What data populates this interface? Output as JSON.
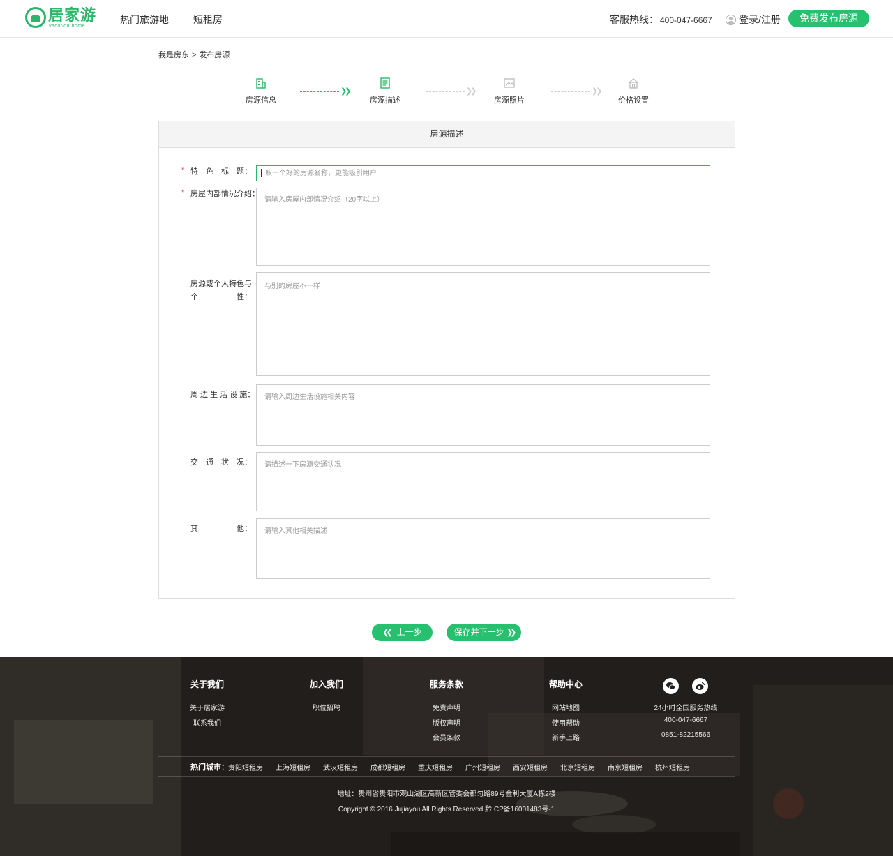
{
  "header": {
    "logo_text": "居家游",
    "logo_sub": "vacation home",
    "nav": [
      "热门旅游地",
      "短租房"
    ],
    "hotline_label": "客服热线：",
    "hotline_number": "400-047-6667",
    "login": "登录/注册",
    "publish": "免费发布房源"
  },
  "breadcrumb": {
    "items": [
      "我是房东",
      "发布房源"
    ],
    "separator": ">"
  },
  "steps": [
    {
      "label": "房源信息",
      "icon": "building-icon"
    },
    {
      "label": "房源描述",
      "icon": "document-icon"
    },
    {
      "label": "房源照片",
      "icon": "picture-icon"
    },
    {
      "label": "价格设置",
      "icon": "house-price-icon"
    }
  ],
  "form": {
    "title": "房源描述",
    "fields": [
      {
        "label": "特　色　标　题：",
        "required": true,
        "placeholder": "取一个好的房源名称，更能吸引用户"
      },
      {
        "label": "房屋内部情况介绍：",
        "required": true,
        "placeholder": "请输入房屋内部情况介绍（20字以上）"
      },
      {
        "label_line1": "房源或个人特色与",
        "label_line2": "个　　　　　性：",
        "required": false,
        "placeholder": "与别的房屋不一样"
      },
      {
        "label": "周 边 生 活 设 施：",
        "required": false,
        "placeholder": "请输入周边生活设施相关内容"
      },
      {
        "label": "交　通　状　况：",
        "required": false,
        "placeholder": "请描述一下房源交通状况"
      },
      {
        "label": "其　　　　　他：",
        "required": false,
        "placeholder": "请输入其他相关描述"
      }
    ],
    "required_mark": "*"
  },
  "buttons": {
    "prev": "上一步",
    "next": "保存并下一步"
  },
  "footer": {
    "columns": [
      {
        "title": "关于我们",
        "links": [
          "关于居家游",
          "联系我们"
        ]
      },
      {
        "title": "加入我们",
        "links": [
          "职位招聘"
        ]
      },
      {
        "title": "服务条款",
        "links": [
          "免责声明",
          "版权声明",
          "会员条款"
        ]
      },
      {
        "title": "帮助中心",
        "links": [
          "网站地图",
          "使用帮助",
          "新手上路"
        ]
      }
    ],
    "service": {
      "title": "24小时全国服务热线",
      "phone1": "400-047-6667",
      "phone2": "0851-82215566"
    },
    "social_icons": [
      "wechat-icon",
      "weibo-icon"
    ],
    "hot_cities_label": "热门城市：",
    "hot_cities": [
      "贵阳短租房",
      "上海短租房",
      "武汉短租房",
      "成都短租房",
      "重庆短租房",
      "广州短租房",
      "西安短租房",
      "北京短租房",
      "南京短租房",
      "杭州短租房"
    ],
    "address": "地址：贵州省贵阳市观山湖区高新区管委会都匀路89号金利大厦A栋2楼",
    "copyright": "Copyright © 2016 Jujiayou All Rights Reserved  黔ICP备16001483号-1"
  },
  "colors": {
    "accent": "#26c06f",
    "required": "#e23b3b"
  }
}
